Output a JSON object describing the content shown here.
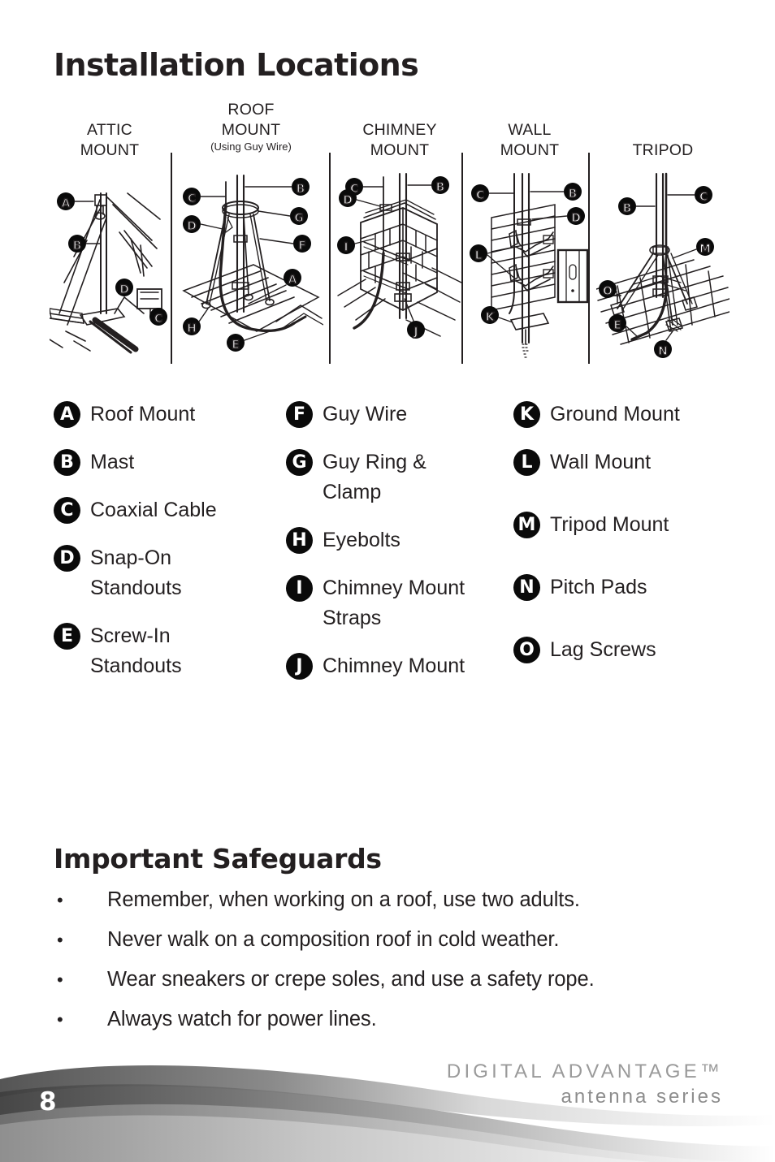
{
  "page": {
    "title": "Installation Locations",
    "number": "8"
  },
  "diagrams": {
    "columns": [
      {
        "title_line1": "ATTIC",
        "title_line2": "MOUNT",
        "subtitle": "",
        "art": "attic-mount-illustration"
      },
      {
        "title_line1": "ROOF",
        "title_line2": "MOUNT",
        "subtitle": "(Using Guy Wire)",
        "art": "roof-mount-illustration"
      },
      {
        "title_line1": "CHIMNEY",
        "title_line2": "MOUNT",
        "subtitle": "",
        "art": "chimney-mount-illustration"
      },
      {
        "title_line1": "WALL",
        "title_line2": "MOUNT",
        "subtitle": "",
        "art": "wall-mount-illustration"
      },
      {
        "title_line1": "TRIPOD",
        "title_line2": "",
        "subtitle": "",
        "art": "tripod-mount-illustration"
      }
    ]
  },
  "legend": {
    "columns": [
      [
        {
          "key": "A",
          "label": "Roof Mount"
        },
        {
          "key": "B",
          "label": "Mast"
        },
        {
          "key": "C",
          "label": "Coaxial Cable"
        },
        {
          "key": "D",
          "label": "Snap-On Standouts"
        },
        {
          "key": "E",
          "label": "Screw-In Standouts"
        }
      ],
      [
        {
          "key": "F",
          "label": "Guy Wire"
        },
        {
          "key": "G",
          "label": "Guy Ring & Clamp"
        },
        {
          "key": "H",
          "label": "Eyebolts"
        },
        {
          "key": "I",
          "label": "Chimney Mount Straps"
        },
        {
          "key": "J",
          "label": "Chimney Mount"
        }
      ],
      [
        {
          "key": "K",
          "label": "Ground Mount"
        },
        {
          "key": "L",
          "label": "Wall Mount"
        },
        {
          "key": "M",
          "label": "Tripod Mount"
        },
        {
          "key": "N",
          "label": "Pitch Pads"
        },
        {
          "key": "O",
          "label": "Lag Screws"
        }
      ]
    ]
  },
  "safeguards": {
    "heading": "Important Safeguards",
    "bullet_glyph": "•",
    "items": [
      "Remember, when working on a roof, use two adults.",
      "Never walk on a composition roof in cold weather.",
      "Wear sneakers or crepe soles, and use a safety rope.",
      "Always watch for power lines."
    ]
  },
  "footer": {
    "brand_line1": "DIGITAL ADVANTAGE™",
    "brand_line2": "antenna series",
    "page_number": "8"
  },
  "colors": {
    "ink": "#231f20",
    "badge_bg": "#0a0a0a",
    "badge_fg": "#ffffff",
    "brand_gray": "#9a9a9a",
    "swoosh_dark": "#4d4d4d",
    "swoosh_mid": "#8c8c8c",
    "swoosh_light": "#c9c9c9"
  }
}
